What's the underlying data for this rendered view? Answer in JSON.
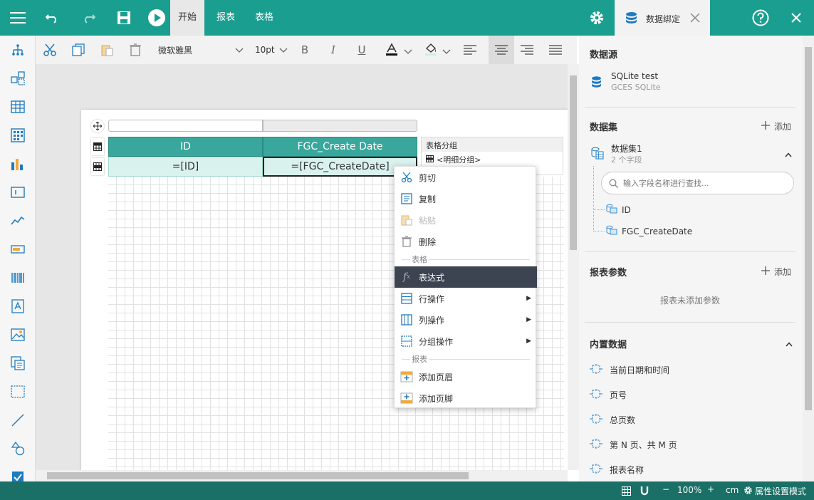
{
  "topbar": {
    "tabs": [
      "开始",
      "报表",
      "表格"
    ],
    "binding_tab": "数据绑定"
  },
  "toolbar": {
    "font_family": "微软雅黑",
    "font_size": "10pt",
    "bold": "B",
    "italic": "I",
    "underline": "U"
  },
  "report": {
    "header_cells": [
      "ID",
      "FGC_Create Date"
    ],
    "detail_cells": [
      "=[ID]",
      "=[FGC_CreateDate]"
    ],
    "group_panel_title": "表格分组",
    "group_item": "<明细分组>"
  },
  "context_menu": {
    "cut": "剪切",
    "copy": "复制",
    "paste": "粘贴",
    "delete": "删除",
    "section_table": "表格",
    "expression": "表达式",
    "row_ops": "行操作",
    "col_ops": "列操作",
    "group_ops": "分组操作",
    "section_report": "报表",
    "add_header": "添加页眉",
    "add_footer": "添加页脚"
  },
  "right_panel": {
    "datasource_title": "数据源",
    "datasource_name": "SQLite test",
    "datasource_type": "GCES SQLite",
    "dataset_title": "数据集",
    "add_label": "添加",
    "dataset_name": "数据集1",
    "dataset_fields": "2 个字段",
    "search_placeholder": "输入字段名称进行查找...",
    "fields": [
      "ID",
      "FGC_CreateDate"
    ],
    "params_title": "报表参数",
    "params_empty": "报表未添加参数",
    "builtin_title": "内置数据",
    "builtin_items": [
      "当前日期和时间",
      "页号",
      "总页数",
      "第 N 页、共 M 页",
      "报表名称"
    ]
  },
  "statusbar": {
    "zoom": "100%",
    "unit": "cm",
    "mode_label": "属性设置模式",
    "minus": "−",
    "plus": "+"
  },
  "colors": {
    "accent": "#1a9e8f",
    "header_cell": "#39a79b",
    "detail_cell": "#d9f2ee",
    "status_bar": "#1a6f66",
    "menu_highlight": "#3d4451"
  }
}
